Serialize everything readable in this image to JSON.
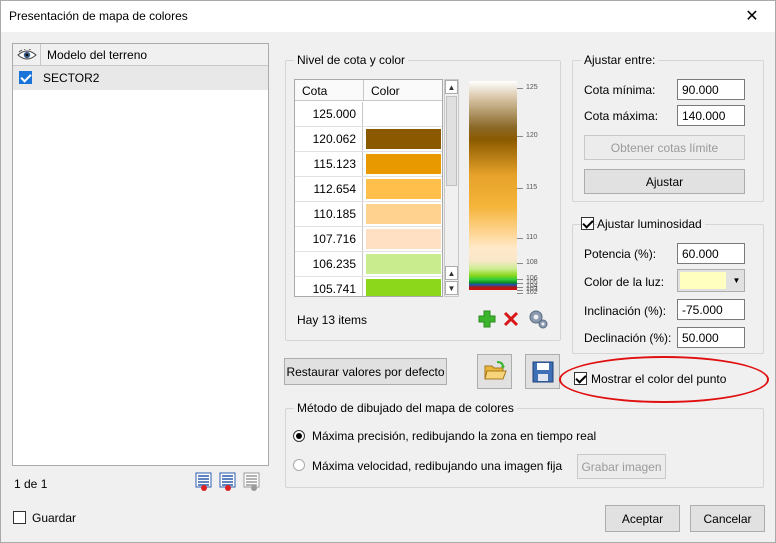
{
  "window": {
    "title": "Presentación de mapa de colores",
    "close_glyph": "✕"
  },
  "terrain_list": {
    "header": "Modelo del terreno",
    "header_icon": "eye-icon",
    "items": [
      {
        "label": "SECTOR2",
        "checked": true
      }
    ],
    "pager": "1 de 1"
  },
  "save_checkbox": {
    "label": "Guardar",
    "checked": false
  },
  "nivel_group": {
    "title": "Nivel de cota y color",
    "columns": [
      "Cota",
      "Color"
    ],
    "rows": [
      {
        "cota": "125.000",
        "color": "#ffffff"
      },
      {
        "cota": "120.062",
        "color": "#8b5a00"
      },
      {
        "cota": "115.123",
        "color": "#e99900"
      },
      {
        "cota": "112.654",
        "color": "#ffbf4a"
      },
      {
        "cota": "110.185",
        "color": "#ffd28f"
      },
      {
        "cota": "107.716",
        "color": "#ffe0c2"
      },
      {
        "cota": "106.235",
        "color": "#c9ed8e"
      },
      {
        "cota": "105.741",
        "color": "#8cd61b"
      }
    ],
    "count_text": "Hay 13 items",
    "scale_labels": [
      "125",
      "120",
      "115",
      "110",
      "108",
      "106",
      "105",
      "104",
      "103",
      "102"
    ],
    "add_icon": "plus-icon",
    "delete_icon": "x-icon",
    "settings_icon": "gear-icon"
  },
  "ajustar_entre": {
    "title": "Ajustar entre:",
    "cota_minima_label": "Cota mínima:",
    "cota_minima_value": "90.000",
    "cota_maxima_label": "Cota máxima:",
    "cota_maxima_value": "140.000",
    "obtener_button": "Obtener cotas límite",
    "ajustar_button": "Ajustar"
  },
  "luminosidad": {
    "title": "Ajustar luminosidad",
    "checked": true,
    "potencia_label": "Potencia (%):",
    "potencia_value": "60.000",
    "color_luz_label": "Color de la luz:",
    "color_luz_value": "#ffffc0",
    "inclinacion_label": "Inclinación (%):",
    "inclinacion_value": "-75.000",
    "declinacion_label": "Declinación (%):",
    "declinacion_value": "50.000"
  },
  "restaurar_button": "Restaurar valores por defecto",
  "open_icon": "folder-open-icon",
  "save_icon": "floppy-icon",
  "mostrar_color": {
    "label": "Mostrar el color del punto",
    "checked": true
  },
  "metodo": {
    "title": "Método de dibujado del mapa de colores",
    "option1": "Máxima precisión, redibujando la zona en tiempo real",
    "option2": "Máxima velocidad, redibujando una imagen fija",
    "selected": 1,
    "grabar_button": "Grabar imagen"
  },
  "footer": {
    "aceptar": "Aceptar",
    "cancelar": "Cancelar"
  },
  "colors": {
    "accent": "#1a73d9",
    "highlight": "#e01010"
  }
}
